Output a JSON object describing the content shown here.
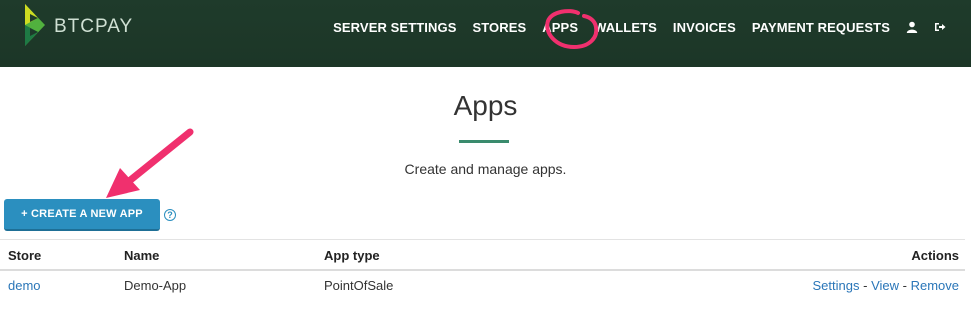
{
  "brand": {
    "name": "BTCPAY",
    "logo_icon": "btcpay-logo-icon"
  },
  "nav": {
    "items": [
      {
        "label": "SERVER SETTINGS"
      },
      {
        "label": "STORES"
      },
      {
        "label": "APPS"
      },
      {
        "label": "WALLETS"
      },
      {
        "label": "INVOICES"
      },
      {
        "label": "PAYMENT REQUESTS"
      }
    ],
    "icons": [
      "user-icon",
      "logout-icon"
    ]
  },
  "page": {
    "title": "Apps",
    "subtitle": "Create and manage apps.",
    "create_button": "+ CREATE A NEW APP",
    "help_icon": "question-circle-icon"
  },
  "table": {
    "headers": {
      "store": "Store",
      "name": "Name",
      "app_type": "App type",
      "actions": "Actions"
    },
    "rows": [
      {
        "store": "demo",
        "name": "Demo-App",
        "app_type": "PointOfSale",
        "actions": {
          "settings": "Settings",
          "view": "View",
          "remove": "Remove",
          "separator": " - "
        }
      }
    ]
  },
  "colors": {
    "navbar": "#1e3a2a",
    "accent_green": "#3a8b6d",
    "button_blue": "#2b8fbf",
    "link_blue": "#2a76b8",
    "annotation_pink": "#f0306e"
  }
}
